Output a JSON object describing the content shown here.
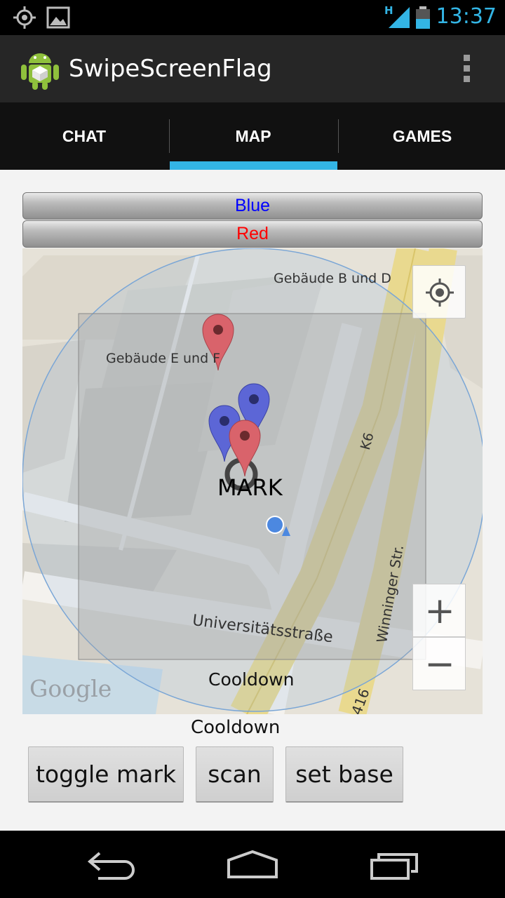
{
  "status_bar": {
    "time": "13:37",
    "network_type": "H",
    "icons": [
      "gps-icon",
      "image-icon",
      "signal-icon",
      "battery-icon"
    ]
  },
  "action_bar": {
    "title": "SwipeScreenFlag",
    "icon": "android-icon",
    "overflow_icon": "overflow-menu-icon"
  },
  "tabs": [
    {
      "label": "CHAT",
      "selected": false
    },
    {
      "label": "MAP",
      "selected": true
    },
    {
      "label": "GAMES",
      "selected": false
    }
  ],
  "team_buttons": {
    "blue_label": "Blue",
    "red_label": "Red",
    "blue_color": "#0000ff",
    "red_color": "#ff0000"
  },
  "map": {
    "labels": {
      "building_bd": "Gebäude B und D",
      "building_ef": "Gebäude E und F",
      "road_k6": "K6",
      "street_winninger": "Winninger Str.",
      "street_universitaet": "Universitätsstraße",
      "road_416": "416"
    },
    "mark_label": "MARK",
    "overlay_text": "Cooldown",
    "attribution": "Google",
    "zoom_in_label": "+",
    "zoom_out_label": "−",
    "marker_colors": {
      "red": "#d9636b",
      "blue": "#5c66d6"
    }
  },
  "cooldown_label": "Cooldown",
  "actions": {
    "toggle_mark": "toggle mark",
    "scan": "scan",
    "set_base": "set base"
  },
  "nav_bar": {
    "icons": [
      "back-icon",
      "home-icon",
      "recent-apps-icon"
    ]
  }
}
